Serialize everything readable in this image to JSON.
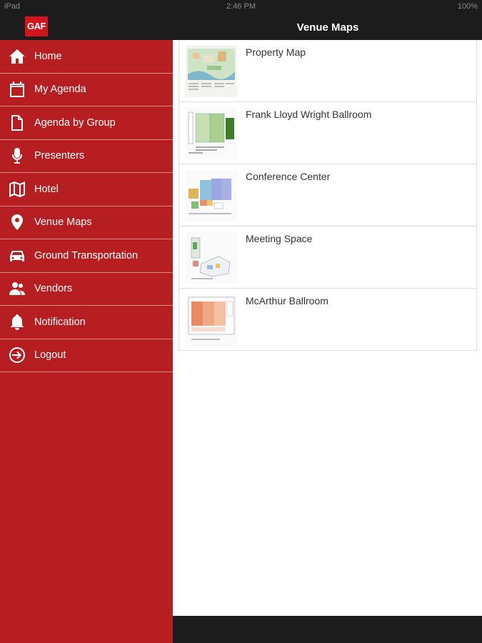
{
  "status_bar": {
    "carrier": "iPad",
    "time": "2:46 PM",
    "battery": "100%"
  },
  "header": {
    "logo_text": "GAF",
    "title": "Venue Maps"
  },
  "sidebar": {
    "items": [
      {
        "label": "Home",
        "icon": "home-icon"
      },
      {
        "label": "My Agenda",
        "icon": "calendar-icon"
      },
      {
        "label": "Agenda by Group",
        "icon": "document-icon"
      },
      {
        "label": "Presenters",
        "icon": "microphone-icon"
      },
      {
        "label": "Hotel",
        "icon": "map-icon"
      },
      {
        "label": "Venue Maps",
        "icon": "location-pin-icon"
      },
      {
        "label": "Ground Transportation",
        "icon": "car-icon"
      },
      {
        "label": "Vendors",
        "icon": "users-icon"
      },
      {
        "label": "Notification",
        "icon": "bell-icon"
      },
      {
        "label": "Logout",
        "icon": "logout-icon"
      }
    ]
  },
  "maps": [
    {
      "label": "Property Map"
    },
    {
      "label": "Frank Lloyd Wright Ballroom"
    },
    {
      "label": "Conference Center"
    },
    {
      "label": "Meeting Space"
    },
    {
      "label": "McArthur Ballroom"
    }
  ],
  "colors": {
    "sidebar": "#b71e22",
    "logo": "#d3141c",
    "header": "#1c1c1c"
  }
}
